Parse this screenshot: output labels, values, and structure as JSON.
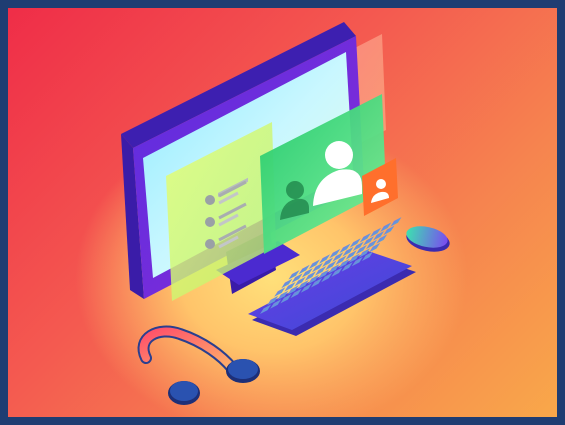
{
  "illustration": {
    "subject": "isometric-video-call-workstation",
    "colors": {
      "frame": "#1f3d72",
      "bg_top_left": "#ef2d48",
      "bg_bottom_right": "#f9a84a",
      "monitor_purple": "#6a2bd8",
      "monitor_screen": "#b7f3ff",
      "panel_green": "#34d66a",
      "avatar_orange": "#ff6f2c",
      "keyboard_body": "#5a3bd6",
      "keyboard_keys": "#2fd8c6",
      "headset_arc": "#ff6a7a",
      "headset_cup": "#2a3f8f",
      "mouse_green": "#56e3a0"
    },
    "elements": [
      "monitor-icon",
      "video-call-panel",
      "user-avatar-icon",
      "small-avatar-badge",
      "chat-list-panel",
      "keyboard",
      "mouse",
      "headset-icon"
    ]
  }
}
